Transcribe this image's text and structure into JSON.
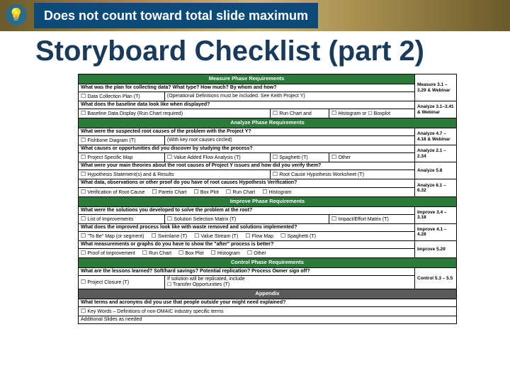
{
  "banner": "Does not count toward total slide maximum",
  "title": "Storyboard Checklist (part 2)",
  "secMeasure": "Measure Phase Requirements",
  "m1q": "What was the plan for collecting data? What type? How much? By whom and how?",
  "m1a": "Data Collection Plan (T)",
  "m1b": "(Operational Definitions must be included. See Keith Project Y)",
  "m1ref": "Measure 3.1 – 3.29 & Webinar",
  "m2q": "What does the baseline data look like when displayed?",
  "m2a": "Baseline Data Display (Run Chart required)",
  "m2b": "Run Chart and",
  "m2c": "Histogram or ☐ Boxplot",
  "m2ref": "Analyze 3.1–3.41 & Webinar",
  "secAnalyze": "Analyze Phase Requirements",
  "a1q": "What were the suspected root causes of the problem with the Project Y?",
  "a1a": "Fishbone Diagram (T)",
  "a1b": "(With key root causes circled)",
  "a1ref": "Analyze 4.7 – 4.18 & Webinar",
  "a2q": "What causes or opportunities did you discover by studying the process?",
  "a2a": "Project Specific Map",
  "a2b": "Value Added Flow Analysis (T)",
  "a2c": "Spaghetti (T)",
  "a2d": "Other",
  "a2ref": "Analyze 2.1 – 2.34",
  "a3q": "What were your main theories about the root causes of Project Y issues and how did you verify them?",
  "a3a": "Hypothesis Statement(s) and & Results",
  "a3b": "Root Cause Hypothesis Worksheet (T)",
  "a3ref": "Analyze 5.8",
  "a4q": "What data, observations or other proof do you have of root causes Hypothesis Verification?",
  "a4a": "Verification of Root Cause",
  "a4b": "Pareto Chart",
  "a4c": "Box Plot",
  "a4d": "Run Chart",
  "a4e": "Histogram",
  "a4ref": "Analyze 6.1 – 6.32",
  "secImprove": "Improve Phase Requirements",
  "i1q": "What were the solutions you developed to solve the problem at the root?",
  "i1a": "List of Improvements",
  "i1b": "Solution Selection Matrix (T)",
  "i1c": "Impact/Effort Matrix (T)",
  "i1ref": "Improve 3.4 – 3.18",
  "i2q": "What does the improved process look like with waste removed and solutions implemented?",
  "i2a": "\"To Be\" Map (or segment)",
  "i2b": "Swimlane (T)",
  "i2c": "Value Stream (T)",
  "i2d": "Flow Map",
  "i2e": "Spaghetti (T)",
  "i2ref": "Improve 4.1 – 4.28",
  "i3q": "What measurements or graphs do you have to show the \"after\" process is better?",
  "i3a": "Proof of Improvement",
  "i3b": "Run Chart",
  "i3c": "Box Plot",
  "i3d": "Histogram",
  "i3e": "Other",
  "i3ref": "Improve 5.29",
  "secControl": "Control Phase Requirements",
  "c1q": "What are the lessons learned? Soft/hard savings? Potential replication? Process Owner sign off?",
  "c1a": "Project Closure (T)",
  "c1b": "If solution will be replicated, include\n☐ Transfer Opportunities (T)",
  "c1ref": "Control 5.3 – 5.5",
  "secAppendix": "Appendix",
  "ap1q": "What terms and acronyms did you use that people outside your might need explained?",
  "ap1a": "Key Words – Definitions of non-DMAIC industry specific terms",
  "ap2": "Additional Slides as needed"
}
